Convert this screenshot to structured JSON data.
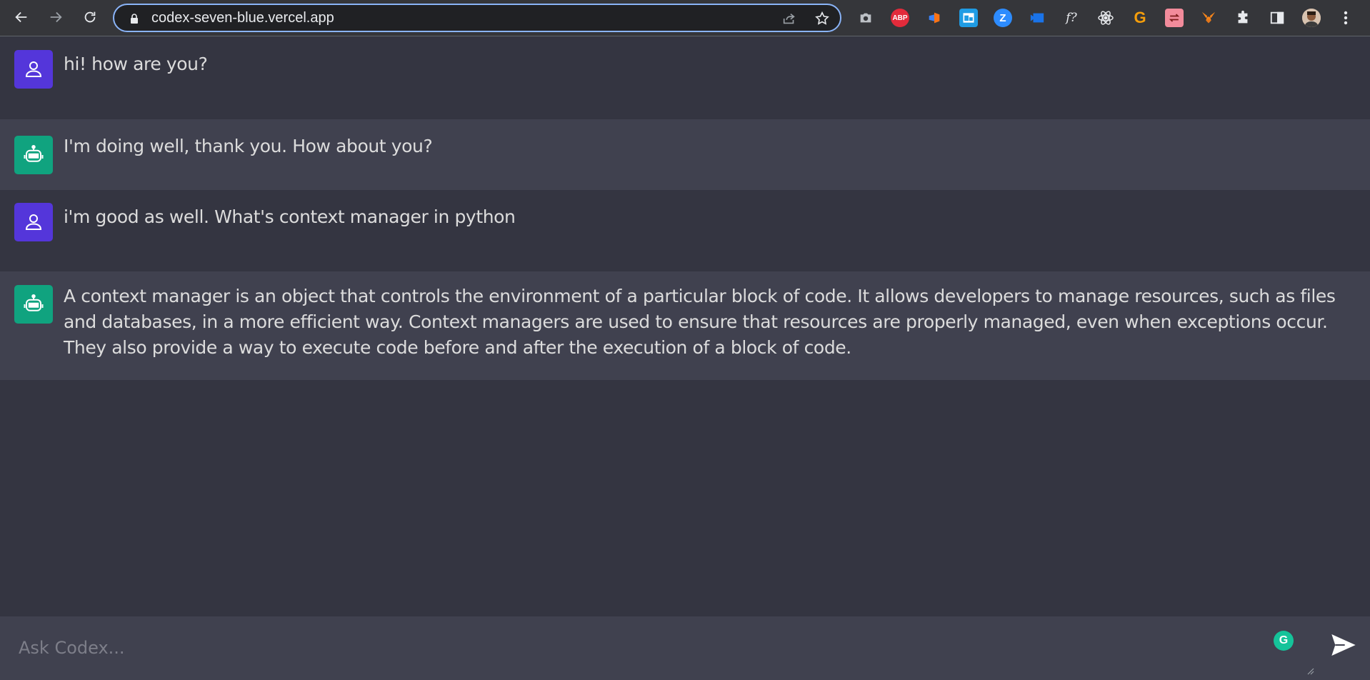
{
  "browser": {
    "url": "codex-seven-blue.vercel.app",
    "extensions": [
      {
        "name": "screenshot-icon",
        "label": ""
      },
      {
        "name": "adblock-plus-icon",
        "label": "ABP"
      },
      {
        "name": "extension-flag-icon",
        "label": ""
      },
      {
        "name": "extension-window-icon",
        "label": ""
      },
      {
        "name": "zoom-icon",
        "label": "Z"
      },
      {
        "name": "extension-media-icon",
        "label": ""
      },
      {
        "name": "function-icon",
        "label": "f?"
      },
      {
        "name": "react-devtools-icon",
        "label": ""
      },
      {
        "name": "grammarly-g-icon",
        "label": "G"
      },
      {
        "name": "extension-sync-icon",
        "label": ""
      },
      {
        "name": "metamask-fox-icon",
        "label": ""
      }
    ]
  },
  "messages": [
    {
      "role": "user",
      "text": "hi! how are you?"
    },
    {
      "role": "bot",
      "text": "I'm doing well, thank you. How about you?"
    },
    {
      "role": "user",
      "text": "i'm good as well. What's context manager in python"
    },
    {
      "role": "bot",
      "text": "A context manager is an object that controls the environment of a particular block of code. It allows developers to manage resources, such as files and databases, in a more efficient way. Context managers are used to ensure that resources are properly managed, even when exceptions occur. They also provide a way to execute code before and after the execution of a block of code."
    }
  ],
  "composer": {
    "placeholder": "Ask Codex...",
    "grammarly_label": "G"
  },
  "colors": {
    "page_bg": "#343541",
    "bot_row_bg": "#40414f",
    "user_avatar": "#5436da",
    "bot_avatar": "#10a37f"
  }
}
